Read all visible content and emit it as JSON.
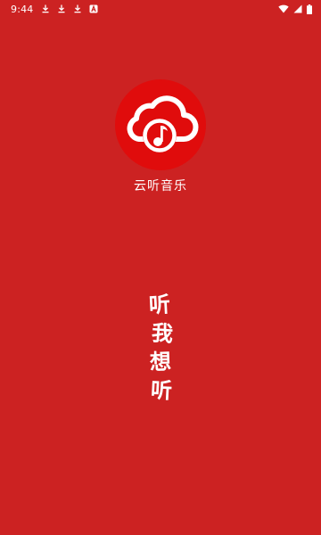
{
  "status_bar": {
    "time": "9:44",
    "notification_icons": [
      "download-icon",
      "download-icon",
      "download-icon",
      "a-icon"
    ],
    "system_icons": [
      "wifi-icon",
      "cellular-signal-icon",
      "battery-icon"
    ]
  },
  "app": {
    "name": "云听音乐",
    "logo_icon": "cloud-music-note-icon",
    "slogan_chars": [
      "听",
      "我",
      "想",
      "听"
    ]
  },
  "colors": {
    "background": "#cc2222",
    "logo_circle": "#e00c0c",
    "text": "#ffffff"
  }
}
